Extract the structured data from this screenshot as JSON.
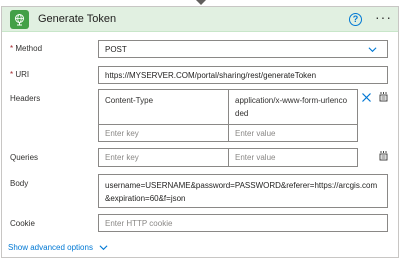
{
  "action": {
    "title": "Generate Token",
    "accent_color": "#43a047"
  },
  "form": {
    "method_label": "Method",
    "method_value": "POST",
    "uri_label": "URI",
    "uri_value": "https://MYSERVER.COM/portal/sharing/rest/generateToken",
    "headers_label": "Headers",
    "headers": {
      "rows": [
        {
          "key": "Content-Type",
          "value": "application/x-www-form-urlencoded"
        }
      ],
      "key_placeholder": "Enter key",
      "value_placeholder": "Enter value"
    },
    "queries_label": "Queries",
    "queries": {
      "key_placeholder": "Enter key",
      "value_placeholder": "Enter value"
    },
    "body_label": "Body",
    "body_value": "username=USERNAME&password=PASSWORD&referer=https://arcgis.com&expiration=60&f=json",
    "cookie_label": "Cookie",
    "cookie_placeholder": "Enter HTTP cookie"
  },
  "footer": {
    "advanced_options": "Show advanced options"
  },
  "icons": {
    "help": "help-icon",
    "more": "more-options-icon",
    "dropdown": "chevron-down-icon",
    "delete": "close-icon",
    "text_mode": "switch-text-mode-icon",
    "app": "globe-icon"
  }
}
